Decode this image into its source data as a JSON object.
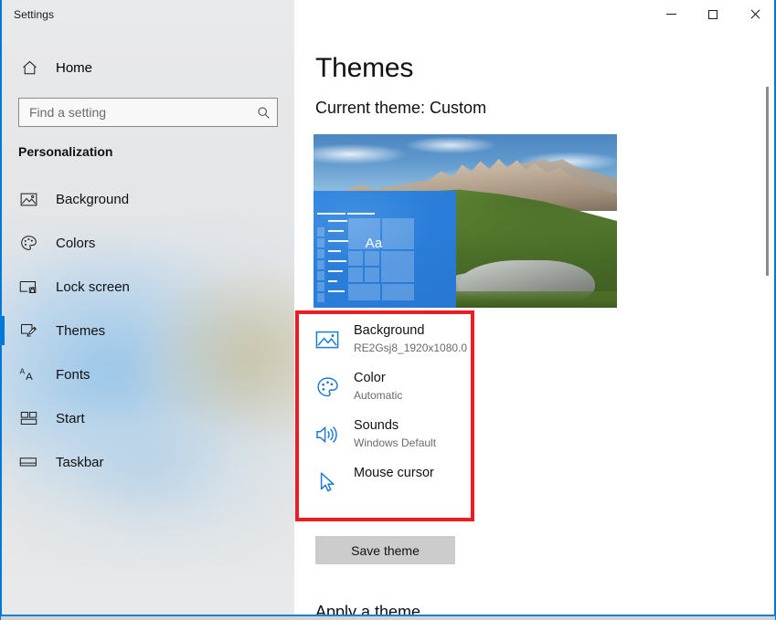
{
  "window": {
    "title": "Settings",
    "caption_buttons": [
      {
        "name": "minimize",
        "glyph": "minimize-icon",
        "label": "Minimize"
      },
      {
        "name": "maximize",
        "glyph": "maximize-icon",
        "label": "Maximize"
      },
      {
        "name": "close",
        "glyph": "close-icon",
        "label": "Close"
      }
    ],
    "accent_color": "#0078d7"
  },
  "sidebar": {
    "home_label": "Home",
    "home_icon": "home-icon",
    "search": {
      "placeholder": "Find a setting",
      "value": "",
      "icon": "search-icon"
    },
    "group_header": "Personalization",
    "items": [
      {
        "label": "Background",
        "icon": "picture-icon",
        "selected": false
      },
      {
        "label": "Colors",
        "icon": "palette-icon",
        "selected": false
      },
      {
        "label": "Lock screen",
        "icon": "lock-screen-icon",
        "selected": false
      },
      {
        "label": "Themes",
        "icon": "theme-brush-icon",
        "selected": true
      },
      {
        "label": "Fonts",
        "icon": "fonts-aa-icon",
        "selected": false
      },
      {
        "label": "Start",
        "icon": "start-tiles-icon",
        "selected": false
      },
      {
        "label": "Taskbar",
        "icon": "taskbar-icon",
        "selected": false
      }
    ]
  },
  "main": {
    "page_title": "Themes",
    "current_theme_label": "Current theme: Custom",
    "preview": {
      "alt": "Mountain landscape wallpaper with blue Start menu preview",
      "sample_text": "Aa"
    },
    "options": [
      {
        "title": "Background",
        "subtitle": "RE2Gsj8_1920x1080.0",
        "icon": "picture-icon"
      },
      {
        "title": "Color",
        "subtitle": "Automatic",
        "icon": "palette-icon"
      },
      {
        "title": "Sounds",
        "subtitle": "Windows Default",
        "icon": "speaker-icon"
      },
      {
        "title": "Mouse cursor",
        "subtitle": "",
        "icon": "cursor-arrow-icon"
      }
    ],
    "save_button_label": "Save theme",
    "next_section_heading": "Apply a theme",
    "annotation": {
      "type": "highlight-rectangle",
      "color": "#ed1c24",
      "targets": "Background, Color, Sounds, Mouse cursor"
    }
  }
}
